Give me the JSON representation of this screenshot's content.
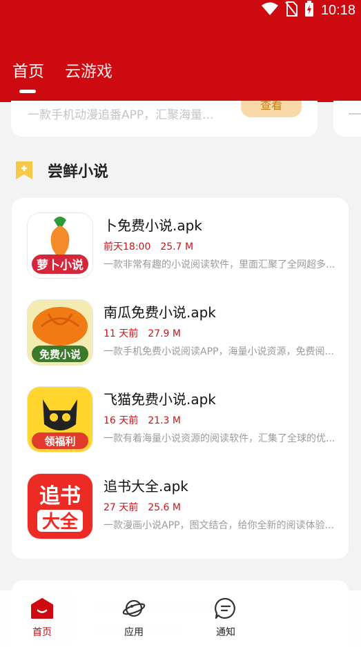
{
  "status_bar": {
    "time": "10:18"
  },
  "tabs": [
    {
      "label": "首页",
      "active": true
    },
    {
      "label": "云游戏",
      "active": false
    }
  ],
  "peek_card": {
    "text": "一款手机动漫追番APP，汇聚海量...",
    "button": "查看"
  },
  "section": {
    "title": "尝鲜小说",
    "icon": "bookmark-plus-icon"
  },
  "apps": [
    {
      "name": "卜免费小说.apk",
      "time": "前天18:00",
      "size": "25.7 M",
      "desc": "一款非常有趣的小说阅读软件，里面汇聚了全网超多...",
      "icon": "carrot-icon",
      "icon_label": "萝卜小说"
    },
    {
      "name": "南瓜免费小说.apk",
      "time": "11 天前",
      "size": "27.9 M",
      "desc": "一款手机免费小说阅读APP，海量小说资源，免费阅...",
      "icon": "pumpkin-icon",
      "icon_label": "免费小说"
    },
    {
      "name": "飞猫免费小说.apk",
      "time": "16 天前",
      "size": "21.3 M",
      "desc": "一款有着海量小说资源的阅读软件，汇集了全球的优...",
      "icon": "cat-icon",
      "icon_label": "领福利"
    },
    {
      "name": "追书大全.apk",
      "time": "27 天前",
      "size": "25.6 M",
      "desc": "一款漫画小说APP，图文结合，给你全新的阅读体验...",
      "icon": "zhuishu-icon",
      "icon_label": "追书大全"
    }
  ],
  "bottom_nav": [
    {
      "label": "首页",
      "icon": "home-icon",
      "active": true
    },
    {
      "label": "应用",
      "icon": "planet-icon",
      "active": false
    },
    {
      "label": "通知",
      "icon": "message-icon",
      "active": false
    }
  ],
  "colors": {
    "brand": "#cc0a10",
    "meta": "#c8161d",
    "accent_button": "#f9d9a8"
  }
}
